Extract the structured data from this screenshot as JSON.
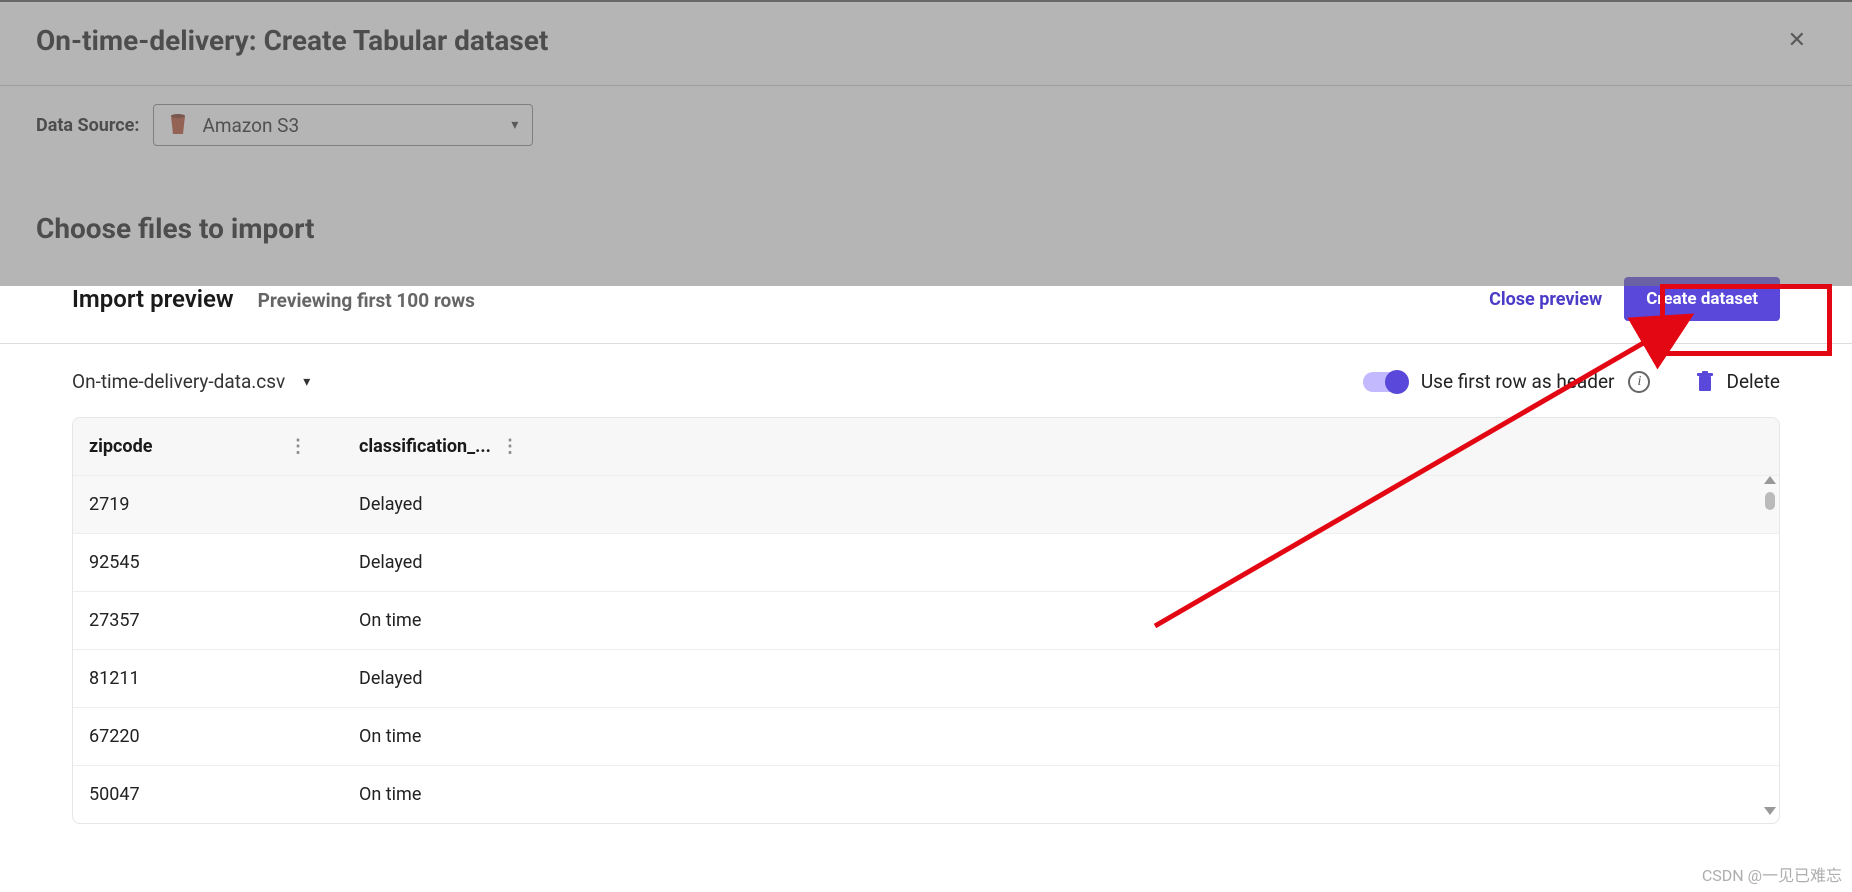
{
  "header": {
    "title": "On-time-delivery: Create Tabular dataset"
  },
  "dataSource": {
    "label": "Data Source:",
    "selected": "Amazon S3"
  },
  "chooseHeading": "Choose files to import",
  "preview": {
    "title": "Import preview",
    "subtitle": "Previewing first 100 rows",
    "closeLabel": "Close preview",
    "createLabel": "Create dataset"
  },
  "fileDropdown": {
    "name": "On-time-delivery-data.csv"
  },
  "controls": {
    "toggleLabel": "Use first row as header",
    "deleteLabel": "Delete"
  },
  "table": {
    "columns": [
      "zipcode",
      "classification_..."
    ],
    "rows": [
      {
        "zipcode": "2719",
        "classification": "Delayed"
      },
      {
        "zipcode": "92545",
        "classification": "Delayed"
      },
      {
        "zipcode": "27357",
        "classification": "On time"
      },
      {
        "zipcode": "81211",
        "classification": "Delayed"
      },
      {
        "zipcode": "67220",
        "classification": "On time"
      },
      {
        "zipcode": "50047",
        "classification": "On time"
      }
    ]
  },
  "watermark": "CSDN @一见已难忘"
}
